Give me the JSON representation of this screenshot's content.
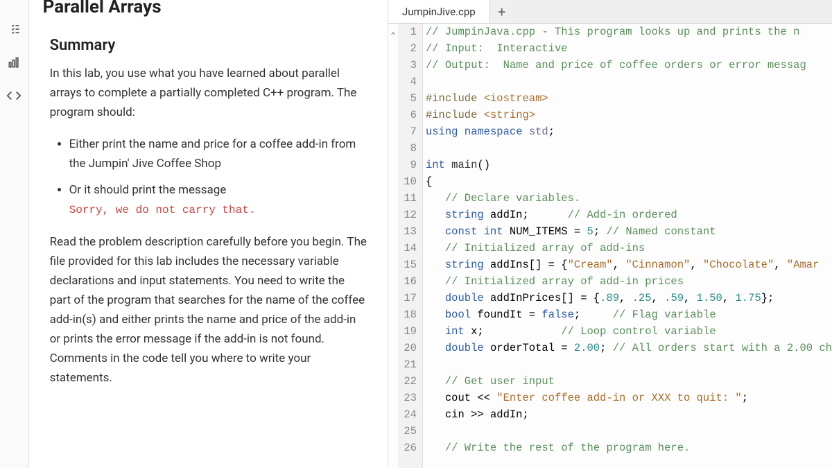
{
  "header": {
    "title": "Parallel Arrays"
  },
  "sidebar_icons": [
    "checklist-icon",
    "chart-icon",
    "code-icon"
  ],
  "summary": {
    "heading": "Summary",
    "intro": "In this lab, you use what you have learned about parallel arrays to complete a partially completed C++ program. The program should:",
    "bullet1": "Either print the name and price for a coffee add-in from the Jumpin' Jive Coffee Shop",
    "bullet2_intro": "Or it should print the message",
    "bullet2_msg": "Sorry, we do not carry that.",
    "para2": "Read the problem description carefully before you begin. The file provided for this lab includes the necessary variable declarations and input statements. You need to write the part of the program that searches for the name of the coffee add-in(s) and either prints the name and price of the add-in or prints the error message if the add-in is not found. Comments in the code tell you where to write your statements."
  },
  "tab": {
    "label": "JumpinJive.cpp",
    "add": "+"
  },
  "code": {
    "lines": [
      {
        "n": 1,
        "html": "<span class='tok-comment'>// JumpinJava.cpp - This program looks up and prints the n</span>"
      },
      {
        "n": 2,
        "html": "<span class='tok-comment'>// Input:  Interactive</span>"
      },
      {
        "n": 3,
        "html": "<span class='tok-comment'>// Output:  Name and price of coffee orders or error messag</span>"
      },
      {
        "n": 4,
        "html": ""
      },
      {
        "n": 5,
        "html": "<span class='tok-pre'>#include</span> <span class='tok-str'>&lt;iostream&gt;</span>"
      },
      {
        "n": 6,
        "html": "<span class='tok-pre'>#include</span> <span class='tok-str'>&lt;string&gt;</span>"
      },
      {
        "n": 7,
        "html": "<span class='tok-key'>using</span> <span class='tok-key'>namespace</span> <span class='tok-ns'>std</span>;"
      },
      {
        "n": 8,
        "html": ""
      },
      {
        "n": 9,
        "html": "<span class='tok-type'>int</span> <span class='tok-id'>main</span>()"
      },
      {
        "n": 10,
        "html": "{"
      },
      {
        "n": 11,
        "html": "   <span class='tok-comment'>// Declare variables.</span>"
      },
      {
        "n": 12,
        "html": "   <span class='tok-type'>string</span> addIn;      <span class='tok-comment'>// Add-in ordered</span>"
      },
      {
        "n": 13,
        "html": "   <span class='tok-key'>const</span> <span class='tok-type'>int</span> NUM_ITEMS = <span class='tok-num'>5</span>; <span class='tok-comment'>// Named constant</span>"
      },
      {
        "n": 14,
        "html": "   <span class='tok-comment'>// Initialized array of add-ins</span>"
      },
      {
        "n": 15,
        "html": "   <span class='tok-type'>string</span> addIns[] = {<span class='tok-str'>\"Cream\"</span>, <span class='tok-str'>\"Cinnamon\"</span>, <span class='tok-str'>\"Chocolate\"</span>, <span class='tok-str'>\"Amar</span>"
      },
      {
        "n": 16,
        "html": "   <span class='tok-comment'>// Initialized array of add-in prices</span>"
      },
      {
        "n": 17,
        "html": "   <span class='tok-type'>double</span> addInPrices[] = {<span class='tok-num'>.89</span>, <span class='tok-num'>.25</span>, <span class='tok-num'>.59</span>, <span class='tok-num'>1.50</span>, <span class='tok-num'>1.75</span>};"
      },
      {
        "n": 18,
        "html": "   <span class='tok-type'>bool</span> foundIt = <span class='tok-key'>false</span>;     <span class='tok-comment'>// Flag variable</span>"
      },
      {
        "n": 19,
        "html": "   <span class='tok-type'>int</span> x;            <span class='tok-comment'>// Loop control variable</span>"
      },
      {
        "n": 20,
        "html": "   <span class='tok-type'>double</span> orderTotal = <span class='tok-num'>2.00</span>; <span class='tok-comment'>// All orders start with a 2.00 ch</span>"
      },
      {
        "n": 21,
        "html": ""
      },
      {
        "n": 22,
        "html": "   <span class='tok-comment'>// Get user input</span>"
      },
      {
        "n": 23,
        "html": "   cout &lt;&lt; <span class='tok-str'>\"Enter coffee add-in or XXX to quit: \"</span>;"
      },
      {
        "n": 24,
        "html": "   cin &gt;&gt; addIn;"
      },
      {
        "n": 25,
        "html": ""
      },
      {
        "n": 26,
        "html": "   <span class='tok-comment'>// Write the rest of the program here.</span>"
      }
    ]
  }
}
